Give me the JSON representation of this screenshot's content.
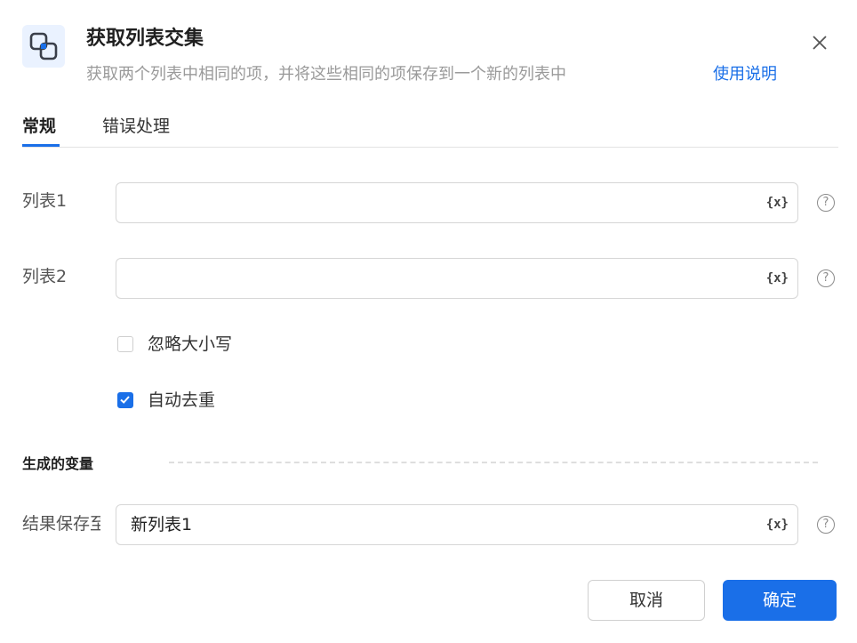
{
  "dialog": {
    "title": "获取列表交集",
    "subtitle": "获取两个列表中相同的项，并将这些相同的项保存到一个新的列表中",
    "help_link": "使用说明",
    "icon": "list-intersection-icon"
  },
  "tabs": [
    {
      "label": "常规",
      "active": true
    },
    {
      "label": "错误处理",
      "active": false
    }
  ],
  "fields": {
    "list1": {
      "label": "列表1",
      "value": ""
    },
    "list2": {
      "label": "列表2",
      "value": ""
    },
    "variable_button": "{x}",
    "help_glyph": "?"
  },
  "options": {
    "ignore_case": {
      "label": "忽略大小写",
      "checked": false
    },
    "auto_dedupe": {
      "label": "自动去重",
      "checked": true
    }
  },
  "output": {
    "section_title": "生成的变量",
    "result_label": "结果保存至",
    "result_value": "新列表1"
  },
  "buttons": {
    "cancel": "取消",
    "ok": "确定"
  },
  "colors": {
    "accent": "#1a6fe8"
  }
}
